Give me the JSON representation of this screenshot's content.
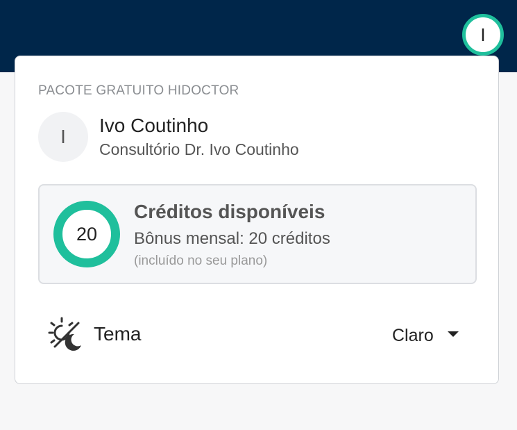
{
  "header": {
    "avatar_initial": "I"
  },
  "menu": {
    "plan_label": "PACOTE GRATUITO HIDOCTOR",
    "user": {
      "initial": "I",
      "name": "Ivo Coutinho",
      "organization": "Consultório Dr. Ivo Coutinho"
    },
    "credits": {
      "count": "20",
      "title": "Créditos disponíveis",
      "bonus": "Bônus mensal: 20 créditos",
      "note": "(incluído no seu plano)"
    },
    "theme": {
      "label": "Tema",
      "selected": "Claro",
      "icon": "theme-toggle-icon"
    }
  },
  "colors": {
    "topbar": "#00264a",
    "accent": "#1fbf9c"
  }
}
